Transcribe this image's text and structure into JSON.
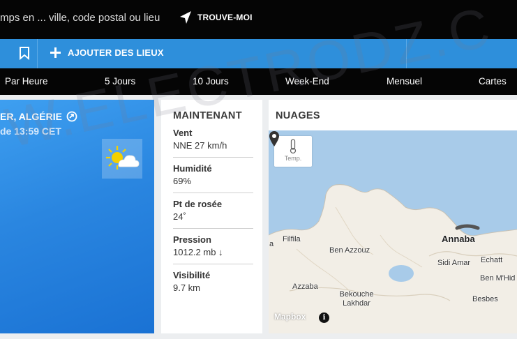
{
  "topbar": {
    "search_placeholder": "mps en ... ville, code postal ou lieu",
    "locate_label": "TROUVE-MOI"
  },
  "bluebar": {
    "add_places_label": "AJOUTER DES LIEUX"
  },
  "nav": {
    "items": [
      "Par Heure",
      "5 Jours",
      "10 Jours",
      "Week-End",
      "Mensuel",
      "Cartes"
    ]
  },
  "current": {
    "location": "ER, ALGÉRIE",
    "time": "de 13:59 CET",
    "weather_icon": "partly-sunny-icon"
  },
  "now": {
    "title": "MAINTENANT",
    "rows": [
      {
        "label": "Vent",
        "value": "NNE 27 km/h"
      },
      {
        "label": "Humidité",
        "value": "69%"
      },
      {
        "label": "Pt de rosée",
        "value": "24˚"
      },
      {
        "label": "Pression",
        "value": "1012.2 mb ↓"
      },
      {
        "label": "Visibilité",
        "value": "9.7 km"
      }
    ]
  },
  "map": {
    "title": "NUAGES",
    "temp_button_label": "Temp.",
    "attribution": "Mapbox",
    "info": "i",
    "cities": [
      "Annaba",
      "Filfila",
      "Ben Azzouz",
      "Sidi Amar",
      "Echatt",
      "Ben M'Hid",
      "Azzaba",
      "Bekouche Lakhdar",
      "Besbes",
      "a"
    ]
  },
  "watermark": "W.ELECTRODZ.C",
  "colors": {
    "accent_blue": "#2e8fdb",
    "dark_bar": "#050505",
    "sea": "#a8cbe9",
    "land": "#f2eee6"
  }
}
